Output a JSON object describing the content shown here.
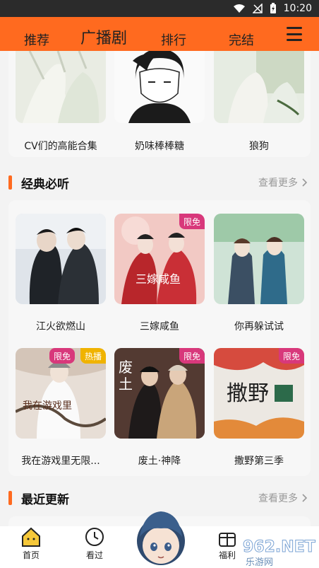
{
  "status": {
    "time": "10:20"
  },
  "nav": {
    "tabs": [
      "推荐",
      "广播剧",
      "排行",
      "完结"
    ],
    "active": "广播剧"
  },
  "top_row": {
    "items": [
      "CV们的高能合集",
      "奶味棒棒糖",
      "狼狗"
    ]
  },
  "classics": {
    "title": "经典必听",
    "more": "查看更多",
    "items": [
      {
        "title": "江火欲燃山",
        "badges": []
      },
      {
        "title": "三嫁咸鱼",
        "badges": [
          "限免"
        ]
      },
      {
        "title": "你再躲试试",
        "badges": []
      },
      {
        "title": "我在游戏里无限...",
        "badges": [
          "限免",
          "热播"
        ]
      },
      {
        "title": "废土·神降",
        "badges": [
          "限免"
        ]
      },
      {
        "title": "撒野第三季",
        "badges": [
          "限免"
        ]
      }
    ]
  },
  "recent": {
    "title": "最近更新",
    "more": "查看更多"
  },
  "bottom_tabs": [
    "首页",
    "看过",
    "福利"
  ],
  "watermark": {
    "text": "962.NET",
    "sub": "乐游网"
  },
  "colors": {
    "accent": "#ff6a1f",
    "free_badge": "#d8387b",
    "hot_badge": "#f0b300"
  }
}
